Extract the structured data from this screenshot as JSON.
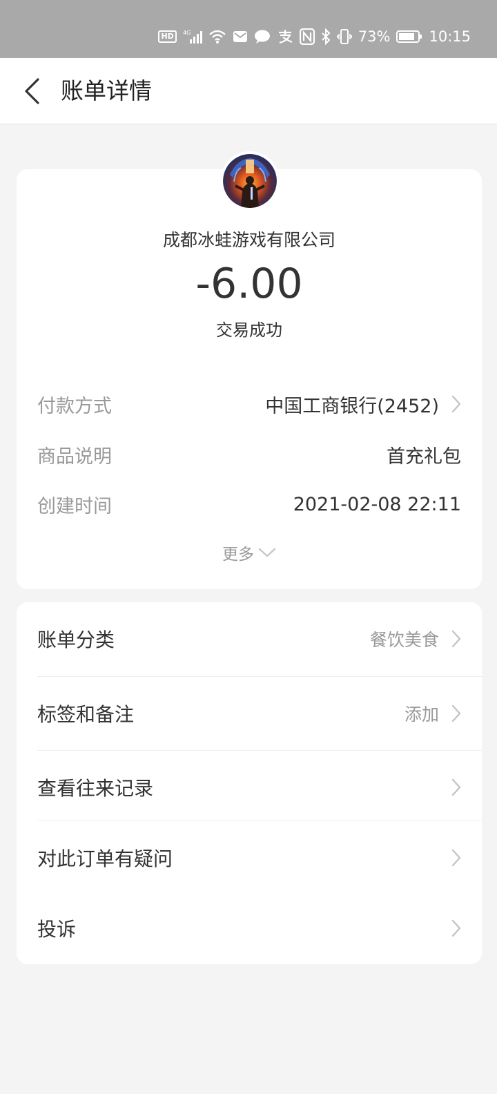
{
  "status_bar": {
    "battery": "73%",
    "time": "10:15",
    "icons": [
      "hd-icon",
      "signal-4g-icon",
      "wifi-icon",
      "mail-icon",
      "message-icon",
      "alipay-icon",
      "nfc-icon",
      "bluetooth-icon",
      "vibrate-icon",
      "battery-icon"
    ]
  },
  "nav": {
    "title": "账单详情"
  },
  "transaction": {
    "merchant": "成都冰蛙游戏有限公司",
    "amount": "-6.00",
    "status": "交易成功",
    "details": [
      {
        "label": "付款方式",
        "value": "中国工商银行(2452)",
        "has_arrow": true
      },
      {
        "label": "商品说明",
        "value": "首充礼包",
        "has_arrow": false
      },
      {
        "label": "创建时间",
        "value": "2021-02-08 22:11",
        "has_arrow": false
      }
    ],
    "more_label": "更多"
  },
  "menu": [
    {
      "label": "账单分类",
      "value": "餐饮美食"
    },
    {
      "label": "标签和备注",
      "value": "添加"
    },
    {
      "label": "查看往来记录",
      "value": ""
    },
    {
      "label": "对此订单有疑问",
      "value": ""
    },
    {
      "label": "投诉",
      "value": ""
    }
  ],
  "colors": {
    "status_bar_bg": "#a9a9a9",
    "page_bg": "#f4f4f4",
    "card_bg": "#ffffff",
    "label_gray": "#999999",
    "text_dark": "#333333"
  }
}
